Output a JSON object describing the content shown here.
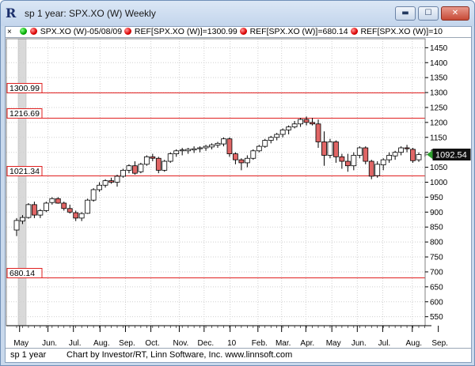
{
  "window": {
    "title": "sp 1 year: SPX.XO (W) Weekly",
    "icon": "R",
    "minimize_glyph": "▬",
    "maximize_glyph": "☐",
    "close_glyph": "✕"
  },
  "info_bar": {
    "close_glyph": "×",
    "symbol_label": "SPX.XO (W)-05/08/09",
    "ref1_label": "REF[SPX.XO (W)]=1300.99",
    "ref2_label": "REF[SPX.XO (W)]=680.14",
    "ref3_label": "REF[SPX.XO (W)]=10"
  },
  "status_bar": {
    "chart_name": "sp 1 year",
    "credit": "Chart by Investor/RT, Linn Software, Inc. www.linnsoft.com"
  },
  "colors": {
    "up_candle": "#ffffff",
    "down_candle": "#e06666",
    "ref_line": "#e02020",
    "last_price_marker": "#2ea02e"
  },
  "chart_data": {
    "type": "candlestick",
    "symbol": "SPX.XO (W)",
    "ylim": [
      520,
      1480
    ],
    "y_ticks": [
      550,
      600,
      650,
      700,
      750,
      800,
      850,
      900,
      950,
      1000,
      1050,
      1100,
      1150,
      1200,
      1250,
      1300,
      1350,
      1400,
      1450
    ],
    "x_ticks": [
      {
        "label": "May",
        "week": 0.5
      },
      {
        "label": "Jun.",
        "week": 5.3
      },
      {
        "label": "Jul.",
        "week": 9.6
      },
      {
        "label": "Aug.",
        "week": 14.1
      },
      {
        "label": "Sep.",
        "week": 18.4
      },
      {
        "label": "Oct.",
        "week": 22.7
      },
      {
        "label": "Nov.",
        "week": 27.5
      },
      {
        "label": "Dec.",
        "week": 31.7
      },
      {
        "label": "10",
        "week": 36.1
      },
      {
        "label": "Feb.",
        "week": 40.8
      },
      {
        "label": "Mar.",
        "week": 44.8
      },
      {
        "label": "Apr.",
        "week": 48.9
      },
      {
        "label": "May",
        "week": 53.3
      },
      {
        "label": "Jun.",
        "week": 57.6
      },
      {
        "label": "Jul.",
        "week": 61.9
      },
      {
        "label": "Aug.",
        "week": 66.9
      },
      {
        "label": "Sep.",
        "week": 71.3
      }
    ],
    "reference_lines": [
      {
        "label": "1300.99",
        "value": 1300.99
      },
      {
        "label": "1216.69",
        "value": 1216.69
      },
      {
        "label": "1021.34",
        "value": 1021.34
      },
      {
        "label": "680.14",
        "value": 680.14
      }
    ],
    "last_price": {
      "label": "1092.54",
      "value": 1092.54
    },
    "candles": [
      {
        "o": 840,
        "h": 880,
        "l": 820,
        "c": 872
      },
      {
        "o": 870,
        "h": 890,
        "l": 860,
        "c": 882
      },
      {
        "o": 882,
        "h": 930,
        "l": 878,
        "c": 925
      },
      {
        "o": 925,
        "h": 935,
        "l": 880,
        "c": 890
      },
      {
        "o": 890,
        "h": 910,
        "l": 880,
        "c": 905
      },
      {
        "o": 905,
        "h": 935,
        "l": 900,
        "c": 930
      },
      {
        "o": 932,
        "h": 950,
        "l": 925,
        "c": 945
      },
      {
        "o": 945,
        "h": 950,
        "l": 928,
        "c": 930
      },
      {
        "o": 930,
        "h": 935,
        "l": 905,
        "c": 912
      },
      {
        "o": 912,
        "h": 925,
        "l": 895,
        "c": 900
      },
      {
        "o": 898,
        "h": 905,
        "l": 870,
        "c": 880
      },
      {
        "o": 880,
        "h": 900,
        "l": 870,
        "c": 895
      },
      {
        "o": 896,
        "h": 945,
        "l": 894,
        "c": 940
      },
      {
        "o": 940,
        "h": 980,
        "l": 935,
        "c": 975
      },
      {
        "o": 975,
        "h": 1000,
        "l": 968,
        "c": 990
      },
      {
        "o": 990,
        "h": 1010,
        "l": 982,
        "c": 1005
      },
      {
        "o": 1005,
        "h": 1015,
        "l": 995,
        "c": 1000
      },
      {
        "o": 1000,
        "h": 1025,
        "l": 985,
        "c": 1020
      },
      {
        "o": 1020,
        "h": 1045,
        "l": 1015,
        "c": 1040
      },
      {
        "o": 1040,
        "h": 1060,
        "l": 1030,
        "c": 1055
      },
      {
        "o": 1055,
        "h": 1070,
        "l": 1025,
        "c": 1030
      },
      {
        "o": 1035,
        "h": 1065,
        "l": 1030,
        "c": 1060
      },
      {
        "o": 1060,
        "h": 1090,
        "l": 1055,
        "c": 1085
      },
      {
        "o": 1085,
        "h": 1095,
        "l": 1070,
        "c": 1080
      },
      {
        "o": 1080,
        "h": 1085,
        "l": 1030,
        "c": 1040
      },
      {
        "o": 1040,
        "h": 1075,
        "l": 1035,
        "c": 1070
      },
      {
        "o": 1070,
        "h": 1100,
        "l": 1065,
        "c": 1095
      },
      {
        "o": 1095,
        "h": 1110,
        "l": 1085,
        "c": 1105
      },
      {
        "o": 1105,
        "h": 1115,
        "l": 1090,
        "c": 1108
      },
      {
        "o": 1105,
        "h": 1115,
        "l": 1095,
        "c": 1110
      },
      {
        "o": 1108,
        "h": 1120,
        "l": 1098,
        "c": 1112
      },
      {
        "o": 1112,
        "h": 1120,
        "l": 1100,
        "c": 1115
      },
      {
        "o": 1115,
        "h": 1125,
        "l": 1105,
        "c": 1120
      },
      {
        "o": 1118,
        "h": 1130,
        "l": 1110,
        "c": 1125
      },
      {
        "o": 1124,
        "h": 1135,
        "l": 1115,
        "c": 1130
      },
      {
        "o": 1128,
        "h": 1150,
        "l": 1120,
        "c": 1145
      },
      {
        "o": 1145,
        "h": 1150,
        "l": 1085,
        "c": 1095
      },
      {
        "o": 1095,
        "h": 1100,
        "l": 1060,
        "c": 1075
      },
      {
        "o": 1075,
        "h": 1080,
        "l": 1040,
        "c": 1065
      },
      {
        "o": 1065,
        "h": 1090,
        "l": 1050,
        "c": 1080
      },
      {
        "o": 1080,
        "h": 1110,
        "l": 1075,
        "c": 1105
      },
      {
        "o": 1105,
        "h": 1125,
        "l": 1100,
        "c": 1120
      },
      {
        "o": 1120,
        "h": 1145,
        "l": 1115,
        "c": 1140
      },
      {
        "o": 1140,
        "h": 1155,
        "l": 1130,
        "c": 1150
      },
      {
        "o": 1150,
        "h": 1165,
        "l": 1140,
        "c": 1160
      },
      {
        "o": 1160,
        "h": 1180,
        "l": 1150,
        "c": 1175
      },
      {
        "o": 1175,
        "h": 1190,
        "l": 1160,
        "c": 1185
      },
      {
        "o": 1185,
        "h": 1205,
        "l": 1180,
        "c": 1195
      },
      {
        "o": 1195,
        "h": 1215,
        "l": 1185,
        "c": 1210
      },
      {
        "o": 1210,
        "h": 1220,
        "l": 1190,
        "c": 1200
      },
      {
        "o": 1200,
        "h": 1215,
        "l": 1190,
        "c": 1195
      },
      {
        "o": 1195,
        "h": 1210,
        "l": 1115,
        "c": 1135
      },
      {
        "o": 1135,
        "h": 1170,
        "l": 1055,
        "c": 1090
      },
      {
        "o": 1090,
        "h": 1145,
        "l": 1080,
        "c": 1135
      },
      {
        "o": 1135,
        "h": 1140,
        "l": 1065,
        "c": 1085
      },
      {
        "o": 1085,
        "h": 1095,
        "l": 1045,
        "c": 1070
      },
      {
        "o": 1070,
        "h": 1095,
        "l": 1035,
        "c": 1055
      },
      {
        "o": 1055,
        "h": 1100,
        "l": 1040,
        "c": 1090
      },
      {
        "o": 1090,
        "h": 1120,
        "l": 1080,
        "c": 1115
      },
      {
        "o": 1115,
        "h": 1120,
        "l": 1060,
        "c": 1070
      },
      {
        "o": 1070,
        "h": 1075,
        "l": 1010,
        "c": 1020
      },
      {
        "o": 1022,
        "h": 1070,
        "l": 1015,
        "c": 1060
      },
      {
        "o": 1058,
        "h": 1080,
        "l": 1040,
        "c": 1075
      },
      {
        "o": 1075,
        "h": 1100,
        "l": 1065,
        "c": 1090
      },
      {
        "o": 1088,
        "h": 1105,
        "l": 1075,
        "c": 1100
      },
      {
        "o": 1100,
        "h": 1120,
        "l": 1090,
        "c": 1115
      },
      {
        "o": 1115,
        "h": 1125,
        "l": 1100,
        "c": 1112
      },
      {
        "o": 1110,
        "h": 1115,
        "l": 1065,
        "c": 1072
      },
      {
        "o": 1075,
        "h": 1100,
        "l": 1068,
        "c": 1092.54
      }
    ]
  }
}
